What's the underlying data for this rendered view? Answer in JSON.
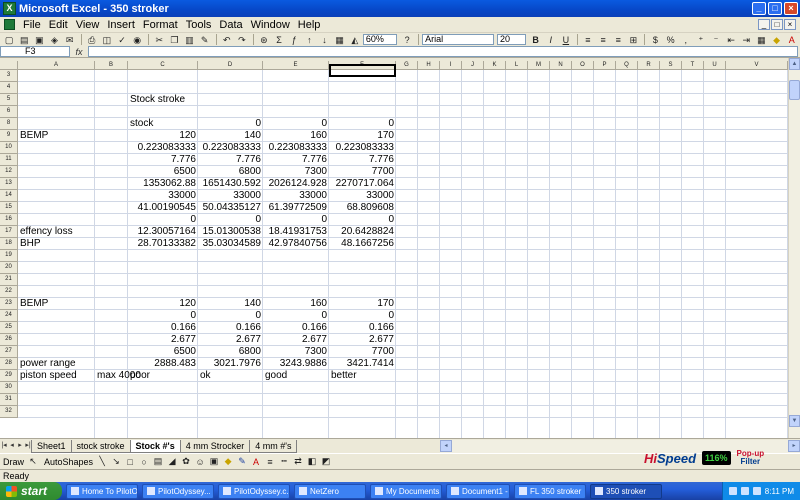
{
  "window": {
    "title": "Microsoft Excel - 350 stroker",
    "controls": [
      "_",
      "□",
      "×"
    ]
  },
  "menu": [
    "File",
    "Edit",
    "View",
    "Insert",
    "Format",
    "Tools",
    "Data",
    "Window",
    "Help"
  ],
  "doc_controls": [
    "_",
    "□",
    "×"
  ],
  "toolbar": {
    "zoom": "60%",
    "font": "Arial",
    "size": "20",
    "icons": [
      "new-icon",
      "open-icon",
      "save-icon",
      "permission-icon",
      "email-icon",
      "print-icon",
      "print-preview-icon",
      "spelling-icon",
      "research-icon",
      "cut-icon",
      "copy-icon",
      "paste-icon",
      "format-painter-icon",
      "undo-icon",
      "redo-icon",
      "hyperlink-icon",
      "autosum-icon",
      "sort-ascending-icon",
      "sort-descending-icon",
      "chart-wizard-icon",
      "drawing-icon"
    ]
  },
  "formula_bar": {
    "name_box": "F3",
    "fx": "fx",
    "value": ""
  },
  "columns": [
    "A",
    "B",
    "C",
    "D",
    "E",
    "F",
    "G",
    "H",
    "I",
    "J",
    "K",
    "L",
    "M",
    "N",
    "O",
    "P",
    "Q",
    "R",
    "S",
    "T",
    "U",
    "V"
  ],
  "rows": [
    "3",
    "4",
    "5",
    "6",
    "8",
    "9",
    "10",
    "11",
    "12",
    "13",
    "14",
    "15",
    "16",
    "17",
    "18",
    "19",
    "20",
    "21",
    "22",
    "23",
    "24",
    "25",
    "26",
    "27",
    "28",
    "29",
    "30",
    "31",
    "32"
  ],
  "cells": [
    {
      "row": 5,
      "col": "C",
      "text": "Stock stroke",
      "align": "l"
    },
    {
      "row": 8,
      "col": "C",
      "text": "stock",
      "align": "l"
    },
    {
      "row": 8,
      "col": "D",
      "text": "0"
    },
    {
      "row": 8,
      "col": "E",
      "text": "0"
    },
    {
      "row": 8,
      "col": "F",
      "text": "0"
    },
    {
      "row": 9,
      "col": "A",
      "text": "BEMP",
      "align": "l"
    },
    {
      "row": 9,
      "col": "C",
      "text": "120"
    },
    {
      "row": 9,
      "col": "D",
      "text": "140"
    },
    {
      "row": 9,
      "col": "E",
      "text": "160"
    },
    {
      "row": 9,
      "col": "F",
      "text": "170"
    },
    {
      "row": 10,
      "col": "C",
      "text": "0.223083333"
    },
    {
      "row": 10,
      "col": "D",
      "text": "0.223083333"
    },
    {
      "row": 10,
      "col": "E",
      "text": "0.223083333"
    },
    {
      "row": 10,
      "col": "F",
      "text": "0.223083333"
    },
    {
      "row": 11,
      "col": "C",
      "text": "7.776"
    },
    {
      "row": 11,
      "col": "D",
      "text": "7.776"
    },
    {
      "row": 11,
      "col": "E",
      "text": "7.776"
    },
    {
      "row": 11,
      "col": "F",
      "text": "7.776"
    },
    {
      "row": 12,
      "col": "C",
      "text": "6500"
    },
    {
      "row": 12,
      "col": "D",
      "text": "6800"
    },
    {
      "row": 12,
      "col": "E",
      "text": "7300"
    },
    {
      "row": 12,
      "col": "F",
      "text": "7700"
    },
    {
      "row": 13,
      "col": "C",
      "text": "1353062.88"
    },
    {
      "row": 13,
      "col": "D",
      "text": "1651430.592"
    },
    {
      "row": 13,
      "col": "E",
      "text": "2026124.928"
    },
    {
      "row": 13,
      "col": "F",
      "text": "2270717.064"
    },
    {
      "row": 14,
      "col": "C",
      "text": "33000"
    },
    {
      "row": 14,
      "col": "D",
      "text": "33000"
    },
    {
      "row": 14,
      "col": "E",
      "text": "33000"
    },
    {
      "row": 14,
      "col": "F",
      "text": "33000"
    },
    {
      "row": 15,
      "col": "C",
      "text": "41.00190545"
    },
    {
      "row": 15,
      "col": "D",
      "text": "50.04335127"
    },
    {
      "row": 15,
      "col": "E",
      "text": "61.39772509"
    },
    {
      "row": 15,
      "col": "F",
      "text": "68.809608"
    },
    {
      "row": 16,
      "col": "C",
      "text": "0"
    },
    {
      "row": 16,
      "col": "D",
      "text": "0"
    },
    {
      "row": 16,
      "col": "E",
      "text": "0"
    },
    {
      "row": 16,
      "col": "F",
      "text": "0"
    },
    {
      "row": 17,
      "col": "A",
      "text": "effency loss",
      "align": "l"
    },
    {
      "row": 17,
      "col": "C",
      "text": "12.30057164"
    },
    {
      "row": 17,
      "col": "D",
      "text": "15.01300538"
    },
    {
      "row": 17,
      "col": "E",
      "text": "18.41931753"
    },
    {
      "row": 17,
      "col": "F",
      "text": "20.6428824"
    },
    {
      "row": 18,
      "col": "A",
      "text": "BHP",
      "align": "l"
    },
    {
      "row": 18,
      "col": "C",
      "text": "28.70133382"
    },
    {
      "row": 18,
      "col": "D",
      "text": "35.03034589"
    },
    {
      "row": 18,
      "col": "E",
      "text": "42.97840756"
    },
    {
      "row": 18,
      "col": "F",
      "text": "48.1667256"
    },
    {
      "row": 23,
      "col": "A",
      "text": "BEMP",
      "align": "l"
    },
    {
      "row": 23,
      "col": "C",
      "text": "120"
    },
    {
      "row": 23,
      "col": "D",
      "text": "140"
    },
    {
      "row": 23,
      "col": "E",
      "text": "160"
    },
    {
      "row": 23,
      "col": "F",
      "text": "170"
    },
    {
      "row": 24,
      "col": "C",
      "text": "0"
    },
    {
      "row": 24,
      "col": "D",
      "text": "0"
    },
    {
      "row": 24,
      "col": "E",
      "text": "0"
    },
    {
      "row": 24,
      "col": "F",
      "text": "0"
    },
    {
      "row": 25,
      "col": "C",
      "text": "0.166"
    },
    {
      "row": 25,
      "col": "D",
      "text": "0.166"
    },
    {
      "row": 25,
      "col": "E",
      "text": "0.166"
    },
    {
      "row": 25,
      "col": "F",
      "text": "0.166"
    },
    {
      "row": 26,
      "col": "C",
      "text": "2.677"
    },
    {
      "row": 26,
      "col": "D",
      "text": "2.677"
    },
    {
      "row": 26,
      "col": "E",
      "text": "2.677"
    },
    {
      "row": 26,
      "col": "F",
      "text": "2.677"
    },
    {
      "row": 27,
      "col": "C",
      "text": "6500"
    },
    {
      "row": 27,
      "col": "D",
      "text": "6800"
    },
    {
      "row": 27,
      "col": "E",
      "text": "7300"
    },
    {
      "row": 27,
      "col": "F",
      "text": "7700"
    },
    {
      "row": 28,
      "col": "A",
      "text": "power range",
      "align": "l"
    },
    {
      "row": 28,
      "col": "C",
      "text": "2888.483"
    },
    {
      "row": 28,
      "col": "D",
      "text": "3021.7976"
    },
    {
      "row": 28,
      "col": "E",
      "text": "3243.9886"
    },
    {
      "row": 28,
      "col": "F",
      "text": "3421.7414"
    },
    {
      "row": 29,
      "col": "A",
      "text": "piston speed",
      "align": "l"
    },
    {
      "row": 29,
      "col": "B",
      "text": "max 4000",
      "align": "l"
    },
    {
      "row": 29,
      "col": "C",
      "text": "poor",
      "align": "l"
    },
    {
      "row": 29,
      "col": "D",
      "text": "ok",
      "align": "l"
    },
    {
      "row": 29,
      "col": "E",
      "text": "good",
      "align": "l"
    },
    {
      "row": 29,
      "col": "F",
      "text": "better",
      "align": "l"
    }
  ],
  "selected_cell": "F3",
  "sheet_tabs": [
    {
      "label": "Sheet1",
      "active": false
    },
    {
      "label": "stock stroke",
      "active": false
    },
    {
      "label": "Stock #'s",
      "active": true
    },
    {
      "label": "4 mm Strocker",
      "active": false
    },
    {
      "label": "4 mm #'s",
      "active": false
    }
  ],
  "drawing_bar": {
    "draw": "Draw",
    "autoshapes": "AutoShapes"
  },
  "addon": {
    "brand_a": "Hi",
    "brand_b": "Speed",
    "percent": "116%",
    "popup_top": "Pop-up",
    "popup_bottom": "Filter"
  },
  "status": "Ready",
  "taskbar": {
    "start": "start",
    "tasks": [
      "Home To PilotO...",
      "PilotOdyssey...",
      "PilotOdyssey.c...",
      "NetZero",
      "My Documents",
      "Document1 - ...",
      "FL 350 stroker",
      "350 stroker"
    ],
    "active_task": 7,
    "clock": "8:11 PM"
  },
  "colors": {
    "title_bar": "#0747c7",
    "grid_line": "#d0d7e5",
    "header": "#ece9d8",
    "taskbar": "#245edb",
    "start": "#2f8a2f"
  }
}
